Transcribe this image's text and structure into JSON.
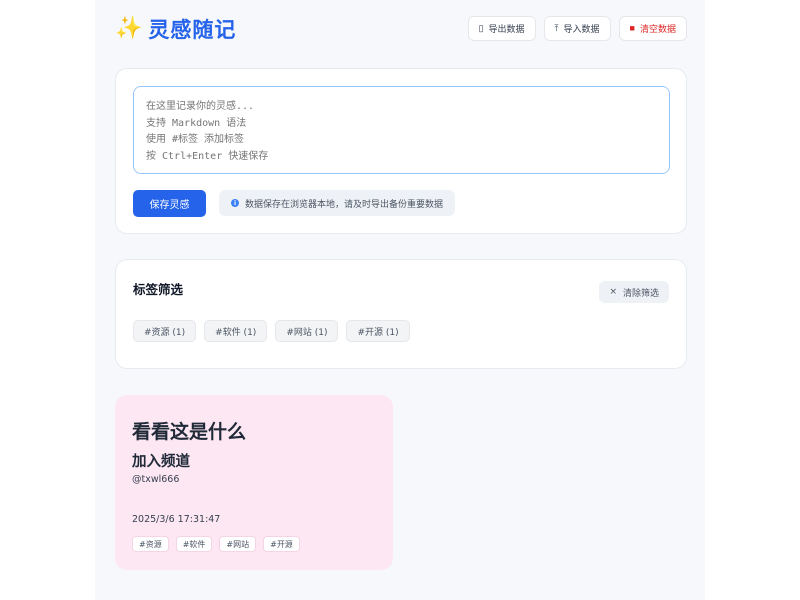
{
  "header": {
    "logo_icon": "sparkles-icon",
    "title": "灵感随记",
    "buttons": [
      {
        "icon": "export-icon",
        "label": "导出数据"
      },
      {
        "icon": "import-icon",
        "label": "导入数据"
      },
      {
        "icon": "trash-icon",
        "label": "清空数据"
      }
    ]
  },
  "editor": {
    "placeholder": "在这里记录你的灵感...\n支持 Markdown 语法\n使用 #标签 添加标签\n按 Ctrl+Enter 快速保存",
    "save_label": "保存灵感",
    "notice": "数据保存在浏览器本地，请及时导出备份重要数据"
  },
  "filter": {
    "title": "标签筛选",
    "clear_label": "清除筛选",
    "tags": [
      "#资源 (1)",
      "#软件 (1)",
      "#网站 (1)",
      "#开源 (1)"
    ]
  },
  "notes": [
    {
      "heading1": "看看这是什么",
      "heading2": "加入频道",
      "text": "@txwl666",
      "time": "2025/3/6 17:31:47",
      "tags": [
        "#资源",
        "#软件",
        "#网站",
        "#开源"
      ],
      "background": "#fde7f3"
    }
  ],
  "colors": {
    "accent": "#2563eb",
    "danger": "#dc2626"
  }
}
